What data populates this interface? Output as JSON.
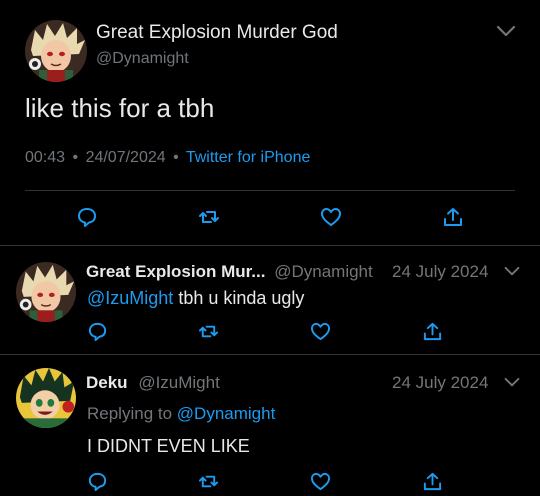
{
  "main_tweet": {
    "display_name": "Great Explosion Murder God",
    "handle": "@Dynamight",
    "text": "like this for a tbh",
    "time": "00:43",
    "date": "24/07/2024",
    "source": "Twitter for iPhone",
    "separator": "•"
  },
  "replies": [
    {
      "display_name": "Great Explosion Mur...",
      "handle": "@Dynamight",
      "date": "24 July 2024",
      "mention": "@IzuMight",
      "text": " tbh u kinda ugly"
    },
    {
      "display_name": "Deku",
      "handle": "@IzuMight",
      "date": "24 July 2024",
      "replying_to_label": "Replying to ",
      "replying_to_handle": "@Dynamight",
      "text": "I DIDNT EVEN LIKE"
    }
  ],
  "icons": {
    "reply": "comment-icon",
    "retweet": "retweet-icon",
    "like": "heart-icon",
    "share": "share-icon",
    "more": "chevron-down-icon"
  },
  "colors": {
    "background": "#000000",
    "text": "#e7e9ea",
    "muted": "#71767b",
    "link": "#1d9bf0",
    "divider": "#2f3336"
  }
}
